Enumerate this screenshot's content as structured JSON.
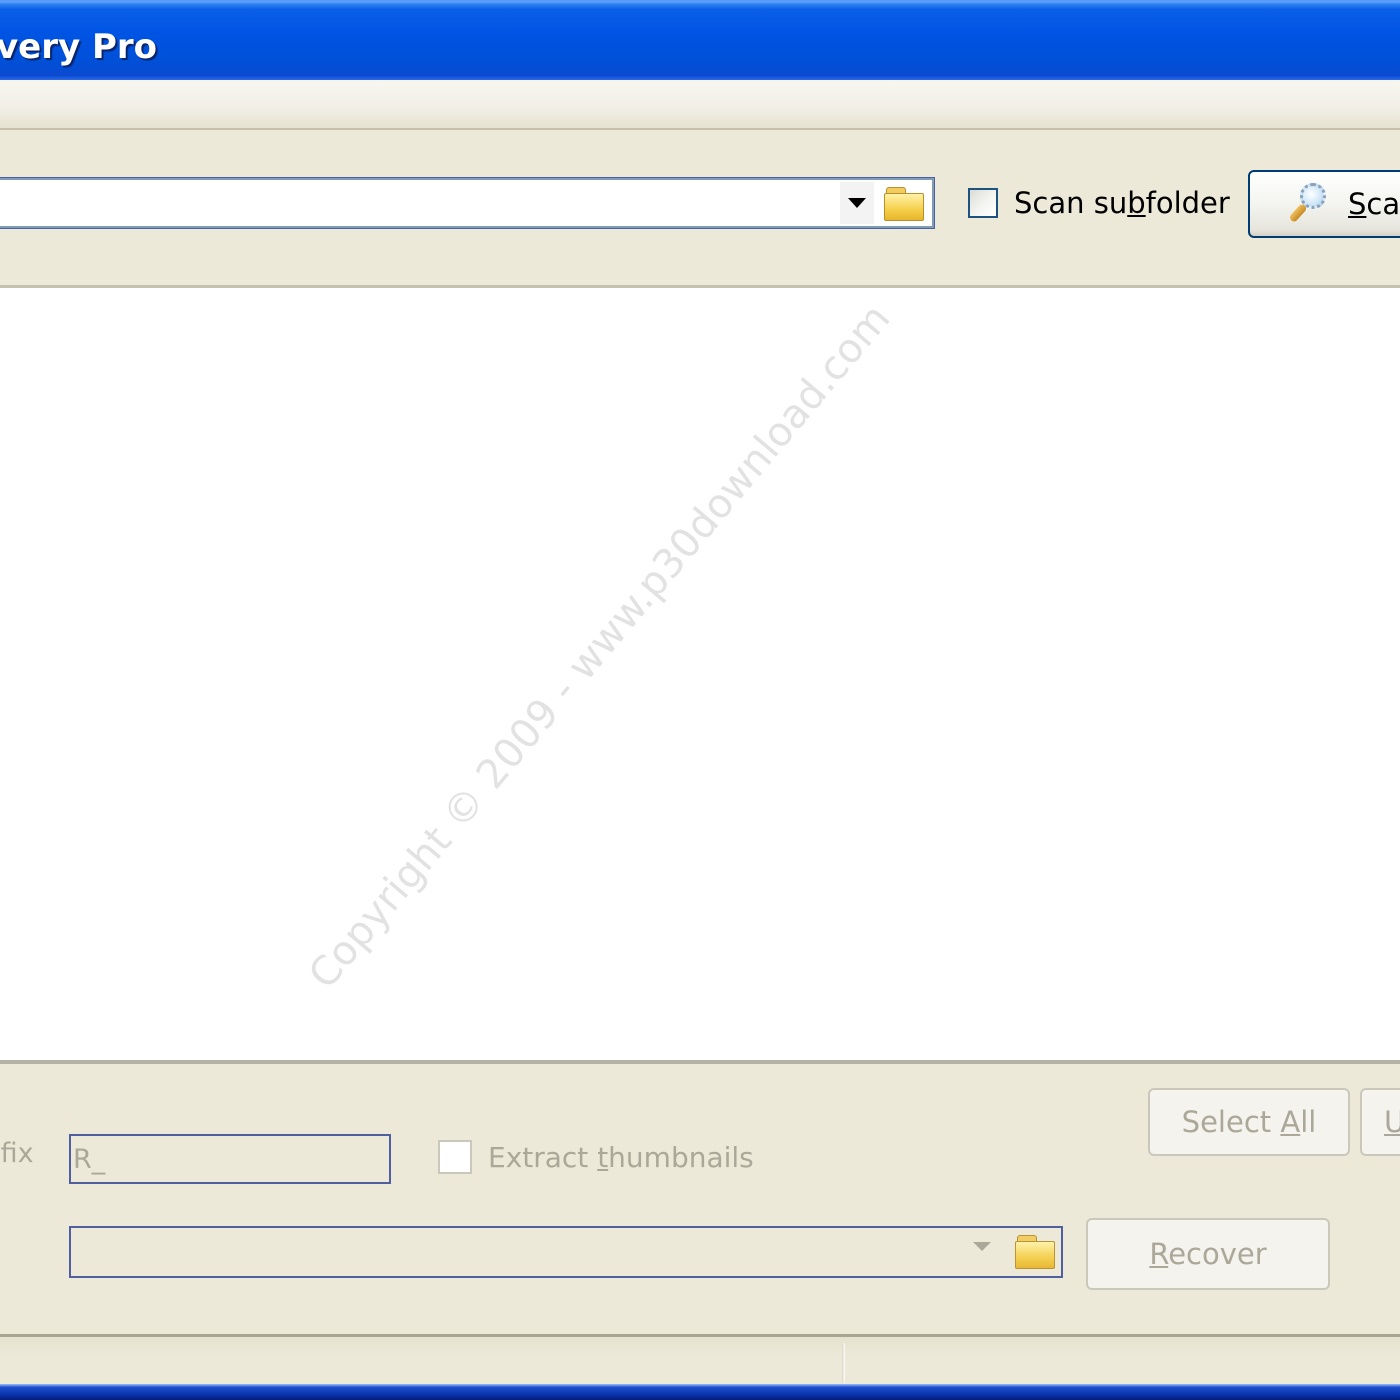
{
  "window": {
    "title": "very Pro"
  },
  "toolbar": {
    "path_value": "",
    "path_dropdown_icon": "chevron-down-icon",
    "browse_icon": "folder-icon",
    "scan_subfolder_label_pre": "Scan su",
    "scan_subfolder_label_mnemonic": "b",
    "scan_subfolder_label_post": "folder",
    "scan_subfolder_checked": false,
    "scan_button_mnemonic": "S",
    "scan_button_rest": "can",
    "scan_button_icon": "magnifier-icon"
  },
  "list": {
    "items": [],
    "watermark": "Copyright © 2009 - www.p30download.com"
  },
  "bottom": {
    "prefix_label": "efix",
    "prefix_value": "R_",
    "extract_thumbnails_pre": "Extract ",
    "extract_thumbnails_mnemonic": "t",
    "extract_thumbnails_post": "humbnails",
    "extract_thumbnails_checked": false,
    "destination_value": "",
    "select_all_pre": "Select ",
    "select_all_mnemonic": "A",
    "select_all_post": "ll",
    "unselect_all_mnemonic": "U",
    "recover_mnemonic": "R",
    "recover_post": "ecover"
  },
  "statusbar": {
    "left_text": "",
    "right_text": ""
  }
}
